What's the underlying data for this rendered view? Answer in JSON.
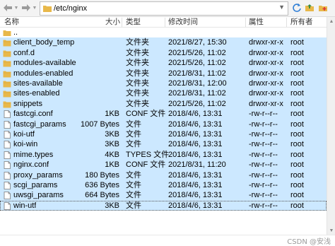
{
  "address_bar": {
    "path": "/etc/nginx"
  },
  "columns": {
    "name": "名称",
    "size": "大小",
    "type": "类型",
    "modified": "修改时间",
    "attributes": "属性",
    "owner": "所有者"
  },
  "colors": {
    "selection": "#cce8ff",
    "folder": "#e8b84a"
  },
  "rows": [
    {
      "name": "..",
      "size": "",
      "type": "",
      "modified": "",
      "attr": "",
      "owner": "",
      "icon": "folder-up-icon",
      "selected": false
    },
    {
      "name": "client_body_temp",
      "size": "",
      "type": "文件夹",
      "modified": "2021/8/27, 15:30",
      "attr": "drwxr-xr-x",
      "owner": "root",
      "icon": "folder-icon",
      "selected": true
    },
    {
      "name": "conf.d",
      "size": "",
      "type": "文件夹",
      "modified": "2021/5/26, 11:02",
      "attr": "drwxr-xr-x",
      "owner": "root",
      "icon": "folder-icon",
      "selected": true
    },
    {
      "name": "modules-available",
      "size": "",
      "type": "文件夹",
      "modified": "2021/5/26, 11:02",
      "attr": "drwxr-xr-x",
      "owner": "root",
      "icon": "folder-icon",
      "selected": true
    },
    {
      "name": "modules-enabled",
      "size": "",
      "type": "文件夹",
      "modified": "2021/8/31, 11:02",
      "attr": "drwxr-xr-x",
      "owner": "root",
      "icon": "folder-icon",
      "selected": true
    },
    {
      "name": "sites-available",
      "size": "",
      "type": "文件夹",
      "modified": "2021/8/31, 12:00",
      "attr": "drwxr-xr-x",
      "owner": "root",
      "icon": "folder-icon",
      "selected": true
    },
    {
      "name": "sites-enabled",
      "size": "",
      "type": "文件夹",
      "modified": "2021/8/31, 11:02",
      "attr": "drwxr-xr-x",
      "owner": "root",
      "icon": "folder-icon",
      "selected": true
    },
    {
      "name": "snippets",
      "size": "",
      "type": "文件夹",
      "modified": "2021/5/26, 11:02",
      "attr": "drwxr-xr-x",
      "owner": "root",
      "icon": "folder-icon",
      "selected": true
    },
    {
      "name": "fastcgi.conf",
      "size": "1KB",
      "type": "CONF 文件",
      "modified": "2018/4/6, 13:31",
      "attr": "-rw-r--r--",
      "owner": "root",
      "icon": "file-icon",
      "selected": true
    },
    {
      "name": "fastcgi_params",
      "size": "1007 Bytes",
      "type": "文件",
      "modified": "2018/4/6, 13:31",
      "attr": "-rw-r--r--",
      "owner": "root",
      "icon": "file-icon",
      "selected": true
    },
    {
      "name": "koi-utf",
      "size": "3KB",
      "type": "文件",
      "modified": "2018/4/6, 13:31",
      "attr": "-rw-r--r--",
      "owner": "root",
      "icon": "file-icon",
      "selected": true
    },
    {
      "name": "koi-win",
      "size": "3KB",
      "type": "文件",
      "modified": "2018/4/6, 13:31",
      "attr": "-rw-r--r--",
      "owner": "root",
      "icon": "file-icon",
      "selected": true
    },
    {
      "name": "mime.types",
      "size": "4KB",
      "type": "TYPES 文件",
      "modified": "2018/4/6, 13:31",
      "attr": "-rw-r--r--",
      "owner": "root",
      "icon": "file-icon",
      "selected": true
    },
    {
      "name": "nginx.conf",
      "size": "1KB",
      "type": "CONF 文件",
      "modified": "2021/8/31, 11:20",
      "attr": "-rw-r--r--",
      "owner": "root",
      "icon": "file-icon",
      "selected": true
    },
    {
      "name": "proxy_params",
      "size": "180 Bytes",
      "type": "文件",
      "modified": "2018/4/6, 13:31",
      "attr": "-rw-r--r--",
      "owner": "root",
      "icon": "file-icon",
      "selected": true
    },
    {
      "name": "scgi_params",
      "size": "636 Bytes",
      "type": "文件",
      "modified": "2018/4/6, 13:31",
      "attr": "-rw-r--r--",
      "owner": "root",
      "icon": "file-icon",
      "selected": true
    },
    {
      "name": "uwsgi_params",
      "size": "664 Bytes",
      "type": "文件",
      "modified": "2018/4/6, 13:31",
      "attr": "-rw-r--r--",
      "owner": "root",
      "icon": "file-icon",
      "selected": true
    },
    {
      "name": "win-utf",
      "size": "3KB",
      "type": "文件",
      "modified": "2018/4/6, 13:31",
      "attr": "-rw-r--r--",
      "owner": "root",
      "icon": "file-icon",
      "selected": true,
      "focused": true
    }
  ],
  "watermark": "CSDN @安浅"
}
